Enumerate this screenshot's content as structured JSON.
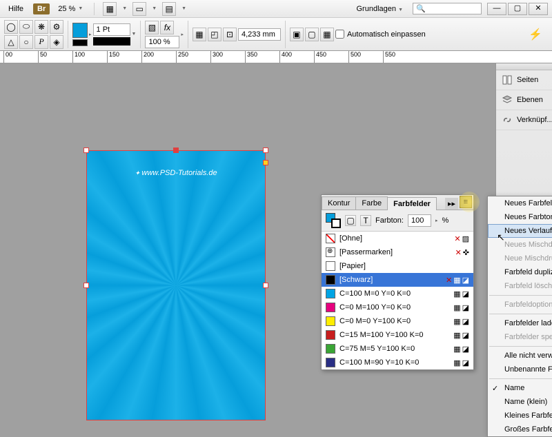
{
  "menubar": {
    "help": "Hilfe",
    "zoom": "25 %",
    "workspace": "Grundlagen",
    "search_placeholder": ""
  },
  "toolbar": {
    "stroke_weight": "1 Pt",
    "opacity": "100 %",
    "measure": "4,233 mm",
    "autofit_cb": "Automatisch einpassen"
  },
  "ruler": [
    "00",
    "50",
    "100",
    "150",
    "200",
    "250",
    "300",
    "350",
    "400",
    "450",
    "500",
    "550"
  ],
  "watermark": "www.PSD-Tutorials.de",
  "right_dock": {
    "pages": "Seiten",
    "layers": "Ebenen",
    "links": "Verknüpf..."
  },
  "swatches_panel": {
    "tabs": [
      "Kontur",
      "Farbe",
      "Farbfelder"
    ],
    "tint_label": "Farbton:",
    "tint_value": "100",
    "tint_unit": "%",
    "rows": [
      {
        "name": "[Ohne]",
        "color": "none",
        "lockX": true,
        "lock": true
      },
      {
        "name": "[Passermarken]",
        "color": "reg",
        "lockX": true,
        "target": true
      },
      {
        "name": "[Papier]",
        "color": "#ffffff"
      },
      {
        "name": "[Schwarz]",
        "color": "#000000",
        "sel": true,
        "lockX": true,
        "proc": true
      },
      {
        "name": "C=100 M=0 Y=0 K=0",
        "color": "#00a4e4",
        "proc": true
      },
      {
        "name": "C=0 M=100 Y=0 K=0",
        "color": "#e6007e",
        "proc": true
      },
      {
        "name": "C=0 M=0 Y=100 K=0",
        "color": "#ffed00",
        "proc": true
      },
      {
        "name": "C=15 M=100 Y=100 K=0",
        "color": "#c71e1e",
        "proc": true
      },
      {
        "name": "C=75 M=5 Y=100 K=0",
        "color": "#3aa535",
        "proc": true
      },
      {
        "name": "C=100 M=90 Y=10 K=0",
        "color": "#2a2f85",
        "proc": true
      }
    ]
  },
  "menu": {
    "items": [
      {
        "label": "Neues Farbfeld"
      },
      {
        "label": "Neues Farbtonf"
      },
      {
        "label": "Neues Verlaufs",
        "hover": true
      },
      {
        "label": "Neues Mischdru",
        "disabled": true
      },
      {
        "label": "Neue Mischdru",
        "disabled": true
      },
      {
        "label": "Farbfeld dupliz"
      },
      {
        "label": "Farbfeld lösche",
        "disabled": true
      },
      {
        "sep": true
      },
      {
        "label": "Farbfeldoption",
        "disabled": true
      },
      {
        "sep": true
      },
      {
        "label": "Farbfelder lade"
      },
      {
        "label": "Farbfelder spei",
        "disabled": true
      },
      {
        "sep": true
      },
      {
        "label": "Alle nicht verw"
      },
      {
        "label": "Unbenannte Fa"
      },
      {
        "sep": true
      },
      {
        "label": "Name",
        "check": true
      },
      {
        "label": "Name (klein)"
      },
      {
        "label": "Kleines Farbfel"
      },
      {
        "label": "Großes Farbfel"
      }
    ]
  }
}
